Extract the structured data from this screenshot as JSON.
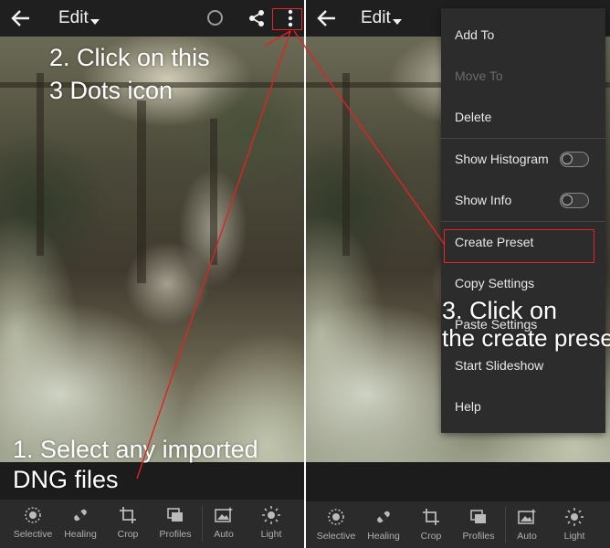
{
  "topbar": {
    "edit_label": "Edit"
  },
  "annotations": {
    "step1_line1": "1. Select any imported",
    "step1_line2": "DNG files",
    "step2_line1": "2. Click on this",
    "step2_line2": "3 Dots icon",
    "step3_line1": "3. Click on",
    "step3_line2": "the create preset"
  },
  "bottom_nav": {
    "items": [
      {
        "label": "Selective",
        "icon": "selective-icon"
      },
      {
        "label": "Healing",
        "icon": "bandage-icon"
      },
      {
        "label": "Crop",
        "icon": "crop-icon"
      },
      {
        "label": "Profiles",
        "icon": "profiles-icon"
      },
      {
        "label": "Auto",
        "icon": "auto-image-icon"
      },
      {
        "label": "Light",
        "icon": "sun-icon"
      }
    ]
  },
  "menu": {
    "items": [
      {
        "label": "Add To",
        "enabled": true
      },
      {
        "label": "Move To",
        "enabled": false
      },
      {
        "label": "Delete",
        "enabled": true
      },
      {
        "label": "Show Histogram",
        "toggle": false
      },
      {
        "label": "Show Info",
        "toggle": false
      },
      {
        "label": "Create Preset",
        "highlighted": true
      },
      {
        "label": "Copy Settings",
        "enabled": true
      },
      {
        "label": "Paste Settings",
        "enabled": true
      },
      {
        "label": "Start Slideshow",
        "enabled": true
      },
      {
        "label": "Help",
        "enabled": true
      }
    ]
  },
  "colors": {
    "highlight": "#e22222",
    "background": "#1c1c1c",
    "menu": "#2c2c2c"
  }
}
